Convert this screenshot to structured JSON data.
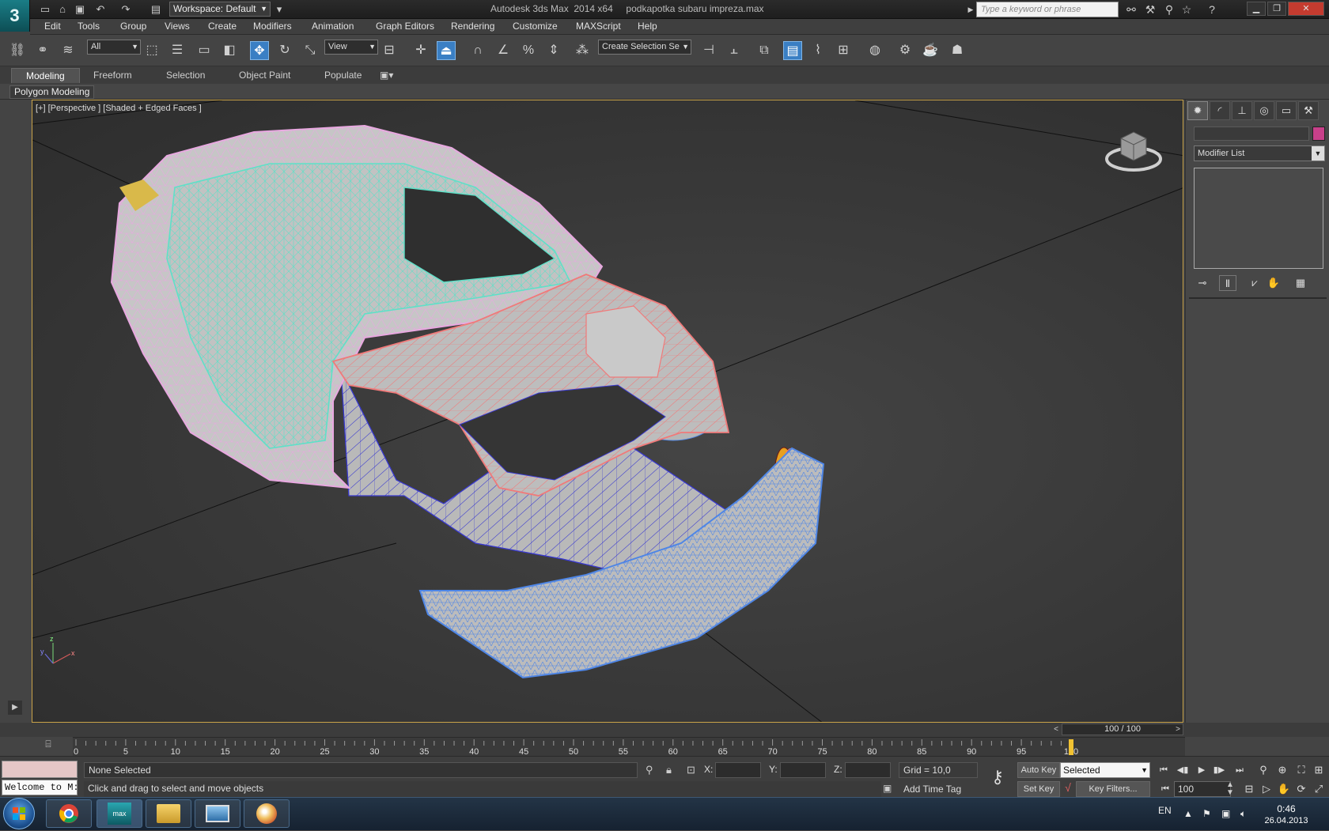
{
  "titlebar": {
    "title": "Autodesk 3ds Max  2014 x64     podkapotka subaru impreza.max",
    "workspace": "Workspace: Default",
    "search_placeholder": "Type a keyword or phrase",
    "app_logo": "3"
  },
  "menu": [
    "Edit",
    "Tools",
    "Group",
    "Views",
    "Create",
    "Modifiers",
    "Animation",
    "Graph Editors",
    "Rendering",
    "Customize",
    "MAXScript",
    "Help"
  ],
  "toolbar": {
    "filter_select": "All",
    "refcoord_select": "View",
    "selection_set": "Create Selection Se"
  },
  "ribbon": {
    "tabs": [
      "Modeling",
      "Freeform",
      "Selection",
      "Object Paint",
      "Populate"
    ],
    "panel_label": "Polygon Modeling"
  },
  "viewport": {
    "label": "[+] [Perspective ] [Shaded + Edged Faces ]",
    "axis_x": "x",
    "axis_y": "y",
    "axis_z": "z",
    "colors": {
      "body": "#e8a8e0",
      "interior": "#5fe0c8",
      "engine_bay": "#f07a7a",
      "under": "#3a3ad0",
      "bumper": "#4f86e6",
      "frame": "#c9a349"
    }
  },
  "command_panel": {
    "modifier_list": "Modifier List",
    "color": "#c8408a"
  },
  "timeline": {
    "slider_label": "100 / 100",
    "current_frame": 100,
    "max_frame": 100,
    "ticks": [
      "0",
      "5",
      "10",
      "15",
      "20",
      "25",
      "30",
      "35",
      "40",
      "45",
      "50",
      "55",
      "60",
      "65",
      "70",
      "75",
      "80",
      "85",
      "90",
      "95",
      "100"
    ]
  },
  "status": {
    "listener": "Welcome to M:",
    "selection": "None Selected",
    "prompt": "Click and drag to select and move objects",
    "x_label": "X:",
    "y_label": "Y:",
    "z_label": "Z:",
    "grid": "Grid = 10,0",
    "add_time_tag": "Add Time Tag",
    "auto_key": "Auto Key",
    "set_key": "Set Key",
    "key_mode": "Selected",
    "key_filters": "Key Filters...",
    "frame_value": "100"
  },
  "taskbar": {
    "lang": "EN",
    "time": "0:46",
    "date": "26.04.2013",
    "app_icon_label": "max"
  }
}
